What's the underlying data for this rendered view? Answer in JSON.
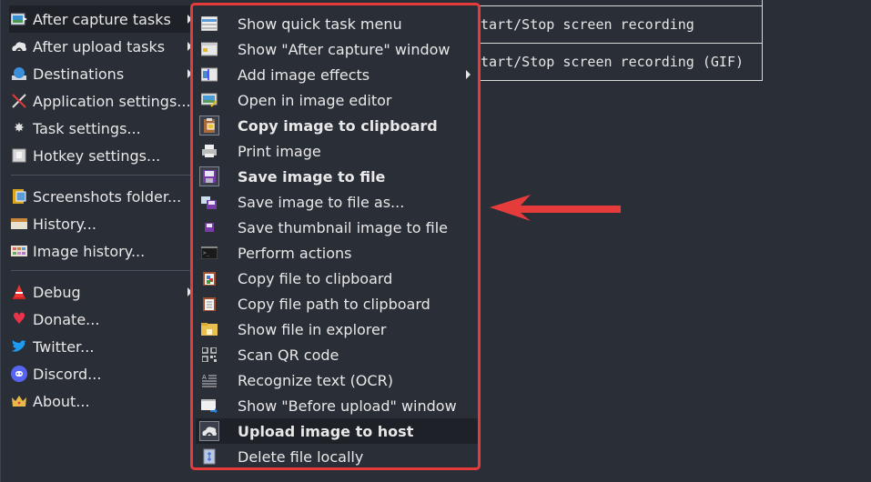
{
  "background_table": {
    "rows": [
      "",
      "Start/Stop screen recording",
      "Start/Stop screen recording (GIF)"
    ]
  },
  "main_menu": {
    "items": [
      {
        "label": "After capture tasks",
        "icon": "image-arrow-icon",
        "submenu": true,
        "active": true
      },
      {
        "label": "After upload tasks",
        "icon": "cloud-upload-icon",
        "submenu": true
      },
      {
        "label": "Destinations",
        "icon": "globe-drive-icon",
        "submenu": true
      },
      {
        "label": "Application settings...",
        "icon": "tools-icon"
      },
      {
        "label": "Task settings...",
        "icon": "gear-icon"
      },
      {
        "label": "Hotkey settings...",
        "icon": "keyboard-key-icon"
      },
      {
        "label": "Screenshots folder...",
        "icon": "folder-icon"
      },
      {
        "label": "History...",
        "icon": "history-icon"
      },
      {
        "label": "Image history...",
        "icon": "image-history-icon"
      },
      {
        "label": "Debug",
        "icon": "traffic-cone-icon",
        "submenu": true
      },
      {
        "label": "Donate...",
        "icon": "heart-icon"
      },
      {
        "label": "Twitter...",
        "icon": "twitter-bird-icon"
      },
      {
        "label": "Discord...",
        "icon": "discord-icon"
      },
      {
        "label": "About...",
        "icon": "crown-icon"
      }
    ]
  },
  "submenu": {
    "items": [
      {
        "label": "Show quick task menu",
        "icon": "list-window-icon"
      },
      {
        "label": "Show \"After capture\" window",
        "icon": "window-icon"
      },
      {
        "label": "Add image effects",
        "icon": "image-effects-icon",
        "submenu": true
      },
      {
        "label": "Open in image editor",
        "icon": "image-edit-icon"
      },
      {
        "label": "Copy image to clipboard",
        "icon": "clipboard-image-icon",
        "checked": true
      },
      {
        "label": "Print image",
        "icon": "printer-icon"
      },
      {
        "label": "Save image to file",
        "icon": "floppy-disk-icon",
        "checked": true
      },
      {
        "label": "Save image to file as...",
        "icon": "save-as-icon"
      },
      {
        "label": "Save thumbnail image to file",
        "icon": "small-floppy-icon"
      },
      {
        "label": "Perform actions",
        "icon": "terminal-icon"
      },
      {
        "label": "Copy file to clipboard",
        "icon": "clipboard-file-icon"
      },
      {
        "label": "Copy file path to clipboard",
        "icon": "clipboard-list-icon"
      },
      {
        "label": "Show file in explorer",
        "icon": "folder-open-icon"
      },
      {
        "label": "Scan QR code",
        "icon": "qr-code-icon"
      },
      {
        "label": "Recognize text (OCR)",
        "icon": "ocr-text-icon"
      },
      {
        "label": "Show \"Before upload\" window",
        "icon": "window-arrow-icon"
      },
      {
        "label": "Upload image to host",
        "icon": "cloud-upload-icon",
        "checked": true,
        "highlighted": true
      },
      {
        "label": "Delete file locally",
        "icon": "delete-file-icon"
      }
    ]
  },
  "annotation": {
    "type": "arrow",
    "color": "#e53b3b",
    "points_to": "Save image to file as..."
  },
  "colors": {
    "background": "#2a2e37",
    "highlight": "#1e2128",
    "annotation_red": "#e53b3b",
    "text": "#e8e8e8"
  }
}
